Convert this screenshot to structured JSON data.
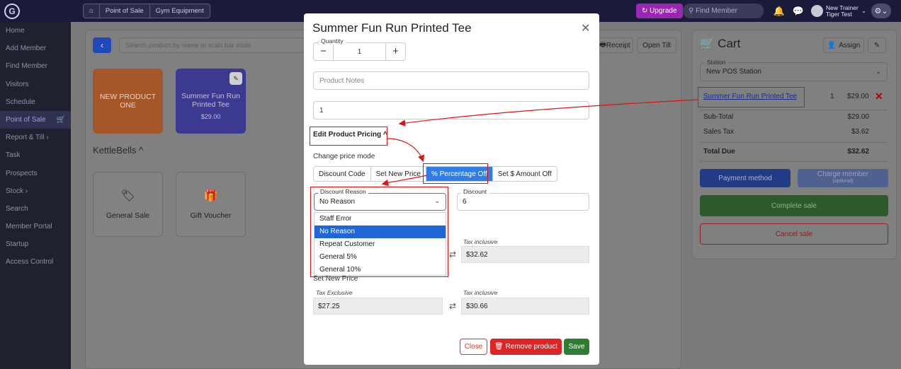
{
  "topbar": {
    "logo": "G",
    "breadcrumbs": [
      "⌂",
      "Point of Sale",
      "Gym Equipment"
    ],
    "upgrade_label": "Upgrade",
    "find_member_placeholder": "Find Member",
    "user_name": "New Trainer",
    "user_sub": "Tiger Test"
  },
  "sidebar": {
    "items": [
      "Home",
      "Add Member",
      "Find Member",
      "Visitors",
      "Schedule",
      "Point of Sale",
      "Report & Till ›",
      "Task",
      "Prospects",
      "Stock ›",
      "Search",
      "Member Portal",
      "Startup",
      "Access Control"
    ],
    "active": "Point of Sale"
  },
  "pos": {
    "search_placeholder": "Search product by name or scan bar code",
    "receipt_label": "Receipt",
    "open_till_label": "Open Till",
    "tiles": [
      {
        "name": "NEW PRODUCT ONE"
      },
      {
        "name": "Summer Fun Run Printed Tee",
        "price": "$29.00"
      }
    ],
    "section": "KettleBells ^",
    "section_tiles": [
      "General Sale",
      "Gift Voucher"
    ]
  },
  "cart": {
    "title": "Cart",
    "assign_label": "Assign",
    "station_label": "Station",
    "station_value": "New POS Station",
    "item": {
      "name": "Summer Fun Run Printed Tee",
      "qty": "1",
      "price": "$29.00"
    },
    "subtotal_label": "Sub-Total",
    "subtotal": "$29.00",
    "tax_label": "Sales Tax",
    "tax": "$3.62",
    "total_label": "Total Due",
    "total": "$32.62",
    "payment_label": "Payment method",
    "charge_label": "Charge member",
    "charge_sub": "(optional)",
    "complete_label": "Complete sale",
    "cancel_label": "Cancel sale"
  },
  "modal": {
    "title": "Summer Fun Run Printed Tee",
    "quantity_label": "Quantity",
    "quantity": "1",
    "notes_placeholder": "Product Notes",
    "second_field_value": "1",
    "edit_pricing_label": "Edit Product Pricing ^",
    "change_mode_label": "Change price mode",
    "modes": [
      "Discount Code",
      "Set New Price",
      "% Percentage Off",
      "Set $ Amount Off"
    ],
    "selected_mode": "% Percentage Off",
    "discount_reason_label": "Discount Reason",
    "discount_reason_value": "No Reason",
    "discount_label": "Discount",
    "discount_value": "6",
    "reason_options": [
      "Staff Error",
      "No Reason",
      "Repeat Customer",
      "General 5%",
      "General 10%"
    ],
    "selected_reason": "No Reason",
    "tax_inclusive_label": "Tax inclusive",
    "current_tax_inclusive": "$32.62",
    "set_new_price_label": "Set New Price",
    "tax_exclusive_label": "Tax Exclusive",
    "new_tax_exclusive": "$27.25",
    "new_tax_inclusive": "$30.66",
    "close_label": "Close",
    "remove_label": "Remove product",
    "save_label": "Save"
  },
  "colors": {
    "annotation": "#e31212",
    "selected_mode": "#2f7de6",
    "save": "#2e7d32",
    "remove": "#dc2626"
  }
}
